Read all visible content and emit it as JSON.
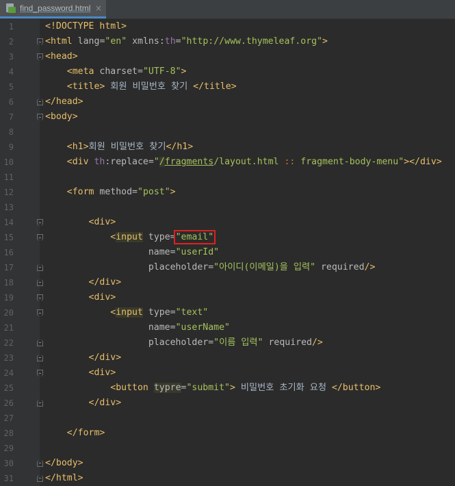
{
  "tab": {
    "filename": "find_password.html",
    "close_glyph": "×",
    "icon": "html-file-icon"
  },
  "code": {
    "l1": "<!DOCTYPE html>",
    "l2": {
      "lt": "<",
      "tag": "html",
      "a1": "lang",
      "eq1": "=",
      "v1": "\"en\"",
      "ns": "xmlns",
      "colon": ":",
      "a2": "th",
      "eq2": "=",
      "v2": "\"http://www.thymeleaf.org\"",
      "gt": ">"
    },
    "l3": "<head>",
    "l4": {
      "open": "<meta ",
      "attr": "charset",
      "eq": "=",
      "val": "\"UTF-8\"",
      "close": ">"
    },
    "l5": {
      "open": "<title>",
      "text": " 회원 비밀번호 찾기 ",
      "close": "</title>"
    },
    "l6": "</head>",
    "l7": "<body>",
    "l9": {
      "open": "<h1>",
      "text": "회원 비밀번호 찾기",
      "close": "</h1>"
    },
    "l10": {
      "open": "<div ",
      "ns": "th",
      "attr": ":replace",
      "eq": "=",
      "q": "\"",
      "p1": "/",
      "frag": "fragments",
      "p2": "/layout.html ",
      "ops": "::",
      "p3": " fragment-body-menu",
      "qe": "\"",
      "close": "></div>"
    },
    "l12": {
      "open": "<form ",
      "attr": "method",
      "eq": "=",
      "val": "\"post\"",
      "close": ">"
    },
    "l14": "<div>",
    "l15": {
      "lt": "<",
      "tag": "input",
      "attr": " type",
      "eq": "=",
      "val": "\"email\""
    },
    "l16": {
      "attr": "name",
      "eq": "=",
      "val": "\"userId\""
    },
    "l17": {
      "attr": "placeholder",
      "eq": "=",
      "val": "\"아이디(이메일)을 입력\"",
      "rest": " required",
      "close": "/>"
    },
    "l18": "</div>",
    "l19": "<div>",
    "l20": {
      "lt": "<",
      "tag": "input",
      "attr": " type",
      "eq": "=",
      "val": "\"text\""
    },
    "l21": {
      "attr": "name",
      "eq": "=",
      "val": "\"userName\""
    },
    "l22": {
      "attr": "placeholder",
      "eq": "=",
      "val": "\"이름 입력\"",
      "rest": " required",
      "close": "/>"
    },
    "l23": "</div>",
    "l24": "<div>",
    "l25": {
      "open": "<button ",
      "attr": "typre",
      "eq": "=",
      "val": "\"submit\"",
      "close": ">",
      "text": " 비밀번호 초기화 요청 ",
      "end": "</button>"
    },
    "l26": "</div>",
    "l28": "</form>",
    "l30": "</body>",
    "l31": "</html>"
  },
  "line_numbers": [
    "1",
    "2",
    "3",
    "4",
    "5",
    "6",
    "7",
    "8",
    "9",
    "10",
    "11",
    "12",
    "13",
    "14",
    "15",
    "16",
    "17",
    "18",
    "19",
    "20",
    "21",
    "22",
    "23",
    "24",
    "25",
    "26",
    "27",
    "28",
    "29",
    "30",
    "31"
  ],
  "colors": {
    "background": "#2b2b2b",
    "tag": "#e8bf6a",
    "attribute": "#bababa",
    "value": "#a5c25c",
    "highlight_box": "#e02020"
  }
}
